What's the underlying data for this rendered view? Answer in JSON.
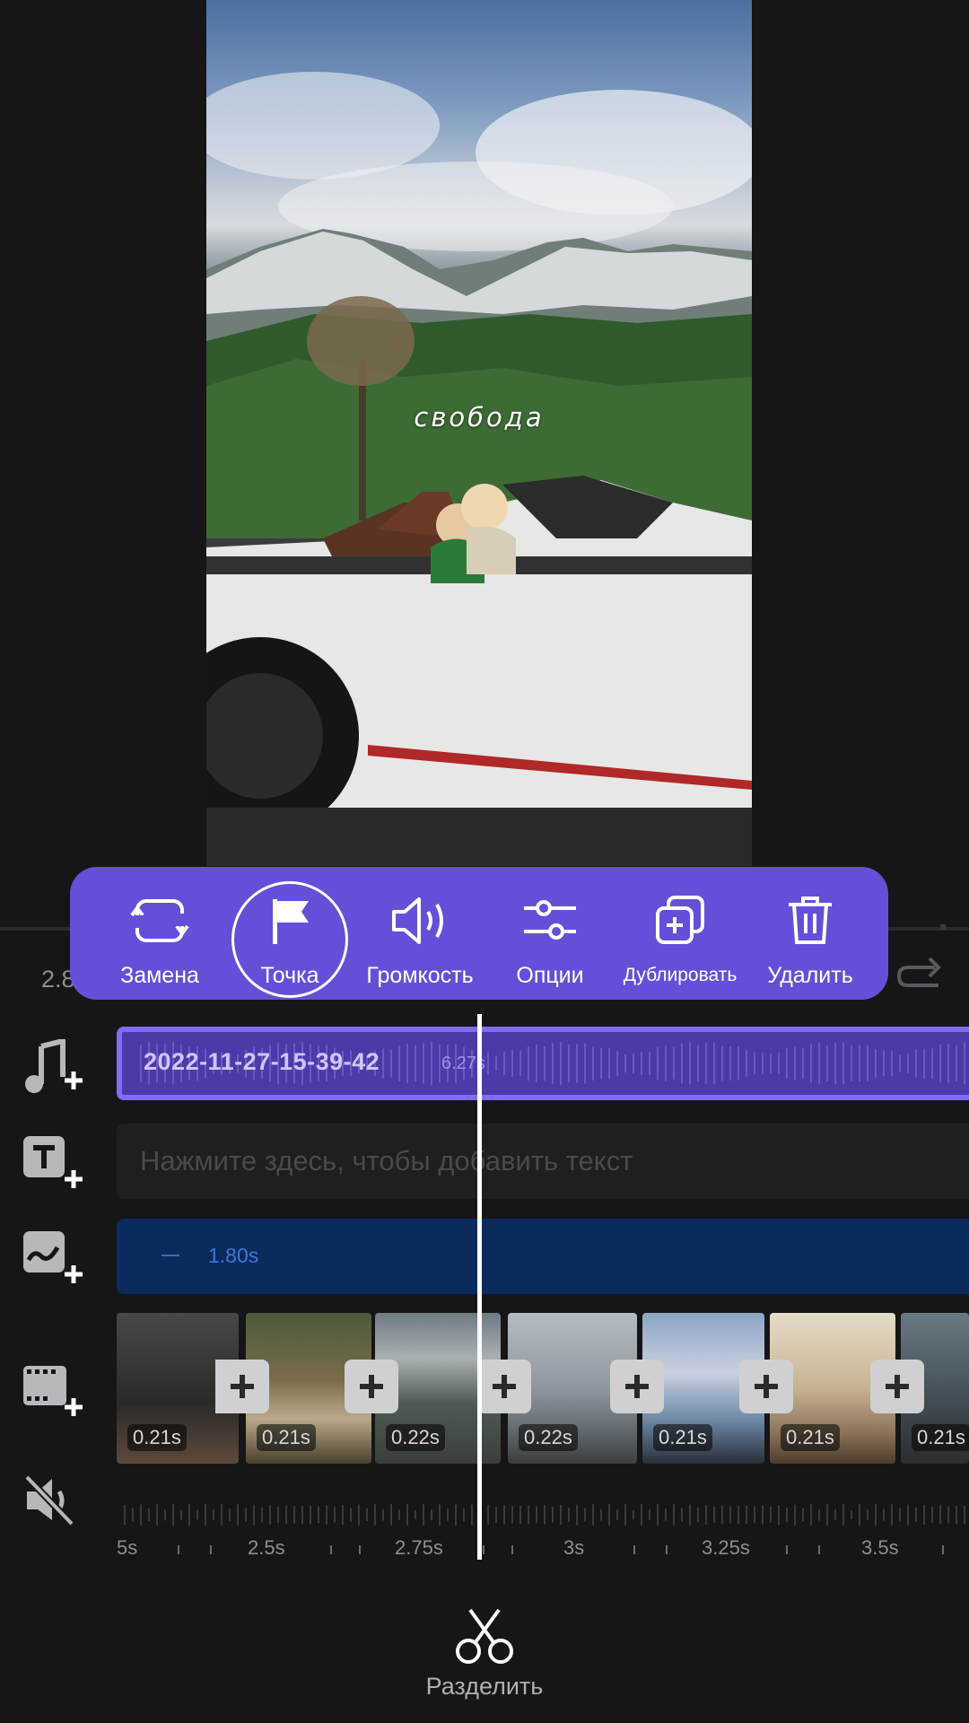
{
  "preview": {
    "caption": "свобода"
  },
  "current_time": "2.8",
  "edit_menu": {
    "items": [
      {
        "label": "Замена",
        "icon": "replace-icon"
      },
      {
        "label": "Точка",
        "icon": "flag-icon",
        "selected": true
      },
      {
        "label": "Громкость",
        "icon": "volume-icon"
      },
      {
        "label": "Опции",
        "icon": "sliders-icon"
      },
      {
        "label": "Дублировать",
        "icon": "duplicate-icon"
      },
      {
        "label": "Удалить",
        "icon": "trash-icon"
      }
    ],
    "accent_color": "#6350d9"
  },
  "tools": [
    {
      "name": "add-music",
      "icon": "music-add-icon"
    },
    {
      "name": "add-text",
      "icon": "text-add-icon"
    },
    {
      "name": "add-effect",
      "icon": "effect-add-icon"
    },
    {
      "name": "add-clip",
      "icon": "film-add-icon"
    },
    {
      "name": "mute",
      "icon": "mute-icon"
    }
  ],
  "timeline": {
    "audio_track": {
      "name": "2022-11-27-15-39-42",
      "duration": "6.27s"
    },
    "text_track": {
      "placeholder": "Нажмите здесь, чтобы добавить текст"
    },
    "effect_track": {
      "duration": "1.80s"
    },
    "clips": [
      {
        "duration": "0.21s"
      },
      {
        "duration": "0.21s"
      },
      {
        "duration": "0.22s"
      },
      {
        "duration": "0.22s"
      },
      {
        "duration": "0.21s"
      },
      {
        "duration": "0.21s"
      },
      {
        "duration": "0.21s"
      }
    ],
    "ruler": [
      "5s",
      "2.5s",
      "2.75s",
      "3s",
      "3.25s",
      "3.5s"
    ]
  },
  "split_button": {
    "label": "Разделить",
    "icon": "scissors-icon"
  }
}
